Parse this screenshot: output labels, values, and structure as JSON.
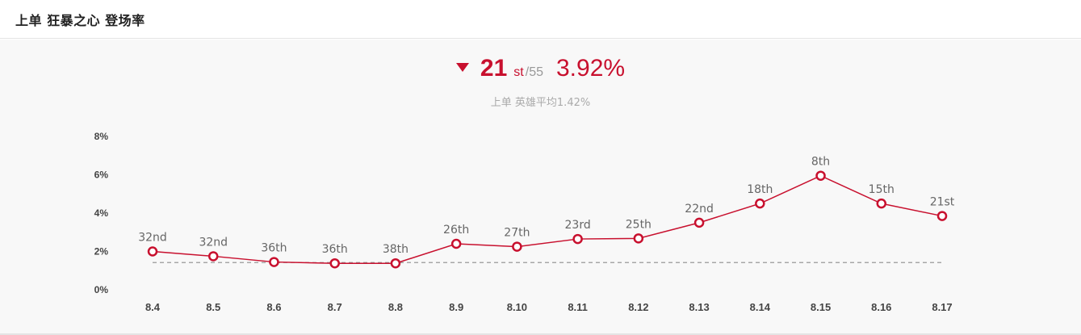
{
  "header": {
    "title": "上单 狂暴之心 登场率"
  },
  "summary": {
    "rank": "21",
    "rank_suffix": "st",
    "rank_total": "/55",
    "rate": "3.92%",
    "trend": "down",
    "average_text": "上单 英雄平均1.42%"
  },
  "colors": {
    "accent": "#c8102e",
    "average_line": "#999999",
    "panel_bg": "#f8f8f8"
  },
  "chart_data": {
    "type": "line",
    "categories": [
      "8.4",
      "8.5",
      "8.6",
      "8.7",
      "8.8",
      "8.9",
      "8.10",
      "8.11",
      "8.12",
      "8.13",
      "8.14",
      "8.15",
      "8.16",
      "8.17"
    ],
    "values": [
      2.0,
      1.75,
      1.45,
      1.38,
      1.38,
      2.4,
      2.25,
      2.65,
      2.68,
      3.5,
      4.5,
      5.95,
      4.5,
      3.85
    ],
    "point_labels": [
      "32nd",
      "32nd",
      "36th",
      "36th",
      "38th",
      "26th",
      "27th",
      "23rd",
      "25th",
      "22nd",
      "18th",
      "8th",
      "15th",
      "21st"
    ],
    "yticks": [
      "0%",
      "2%",
      "4%",
      "6%",
      "8%"
    ],
    "ylim": [
      0,
      8
    ],
    "average_value": 1.42,
    "title": "",
    "xlabel": "",
    "ylabel": ""
  }
}
